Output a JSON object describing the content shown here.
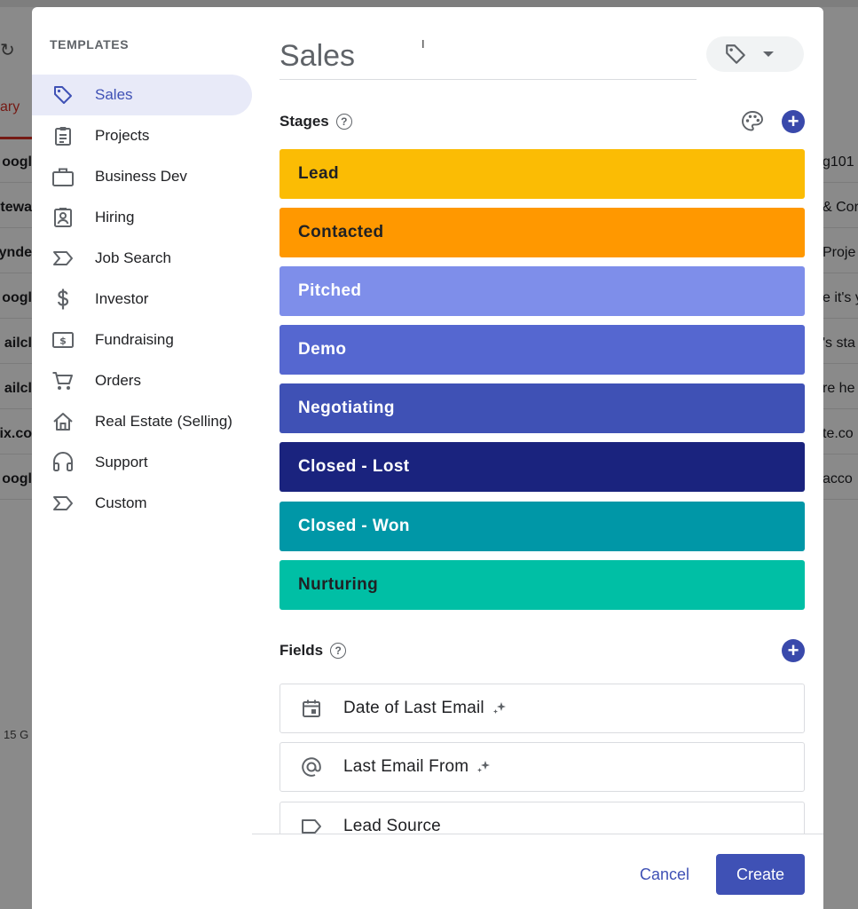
{
  "background": {
    "left_rows": [
      "oogl",
      "tewa",
      "ynde",
      "oogl",
      "ailcl",
      "ailcl",
      "Vix.co",
      "oogl"
    ],
    "right_rows": [
      "g101",
      "& Cor",
      "Proje",
      "e it's y",
      "'s sta",
      "re he",
      "te.co",
      "acco"
    ],
    "primary_tab": "ary",
    "storage": "15 G"
  },
  "sidebar": {
    "title": "TEMPLATES",
    "items": [
      {
        "label": "Sales",
        "icon": "tag-icon",
        "active": true
      },
      {
        "label": "Projects",
        "icon": "clipboard-icon"
      },
      {
        "label": "Business Dev",
        "icon": "briefcase-icon"
      },
      {
        "label": "Hiring",
        "icon": "badge-icon"
      },
      {
        "label": "Job Search",
        "icon": "label-arrow-icon"
      },
      {
        "label": "Investor",
        "icon": "dollar-icon"
      },
      {
        "label": "Fundraising",
        "icon": "money-bill-icon"
      },
      {
        "label": "Orders",
        "icon": "cart-icon"
      },
      {
        "label": "Real Estate (Selling)",
        "icon": "home-icon"
      },
      {
        "label": "Support",
        "icon": "headset-icon"
      },
      {
        "label": "Custom",
        "icon": "label-arrow-icon"
      }
    ]
  },
  "main": {
    "title_value": "Sales",
    "cursor_glyph": "I",
    "stages_label": "Stages",
    "fields_label": "Fields",
    "help_glyph": "?",
    "plus_glyph": "+",
    "stages": [
      {
        "name": "Lead",
        "color": "#fbbc04",
        "text_color": "#202124"
      },
      {
        "name": "Contacted",
        "color": "#ff9800",
        "text_color": "#202124"
      },
      {
        "name": "Pitched",
        "color": "#7e8eea",
        "text_color": "#ffffff"
      },
      {
        "name": "Demo",
        "color": "#5567d0",
        "text_color": "#ffffff"
      },
      {
        "name": "Negotiating",
        "color": "#3f51b5",
        "text_color": "#ffffff"
      },
      {
        "name": "Closed - Lost",
        "color": "#1a237e",
        "text_color": "#ffffff"
      },
      {
        "name": "Closed - Won",
        "color": "#0097a7",
        "text_color": "#ffffff"
      },
      {
        "name": "Nurturing",
        "color": "#00bfa5",
        "text_color": "#202124"
      }
    ],
    "fields": [
      {
        "label": "Date of Last Email",
        "icon": "calendar-icon",
        "auto": true
      },
      {
        "label": "Last Email From",
        "icon": "at-sign-icon",
        "auto": true
      },
      {
        "label": "Lead Source",
        "icon": "label-icon",
        "auto": false
      }
    ]
  },
  "footer": {
    "cancel_label": "Cancel",
    "create_label": "Create"
  },
  "colors": {
    "accent": "#3f51b5",
    "active_bg": "#e8eaf8"
  }
}
